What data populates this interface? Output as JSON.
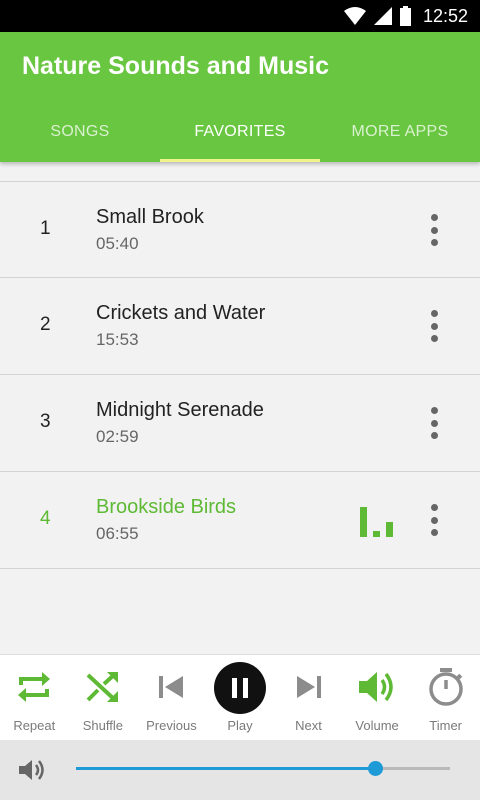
{
  "status": {
    "time": "12:52"
  },
  "app": {
    "title": "Nature Sounds and Music"
  },
  "tabs": [
    {
      "label": "SONGS",
      "active": false
    },
    {
      "label": "FAVORITES",
      "active": true
    },
    {
      "label": "MORE APPS",
      "active": false
    }
  ],
  "tracks": [
    {
      "number": "1",
      "title": "Small Brook",
      "duration": "05:40"
    },
    {
      "number": "2",
      "title": "Crickets and Water",
      "duration": "15:53"
    },
    {
      "number": "3",
      "title": "Midnight Serenade",
      "duration": "02:59"
    },
    {
      "number": "4",
      "title": "Brookside Birds",
      "duration": "06:55",
      "playing": true
    }
  ],
  "controls": [
    {
      "label": "Repeat",
      "icon": "repeat-icon"
    },
    {
      "label": "Shuffle",
      "icon": "shuffle-icon"
    },
    {
      "label": "Previous",
      "icon": "skip-previous-icon"
    },
    {
      "label": "Play",
      "icon": "pause-icon"
    },
    {
      "label": "Next",
      "icon": "skip-next-icon"
    },
    {
      "label": "Volume",
      "icon": "volume-icon"
    },
    {
      "label": "Timer",
      "icon": "timer-icon"
    }
  ],
  "volume": {
    "level": 0.8
  },
  "colors": {
    "accent": "#69c641",
    "playing": "#5eba35",
    "slider": "#1e9ad6"
  }
}
